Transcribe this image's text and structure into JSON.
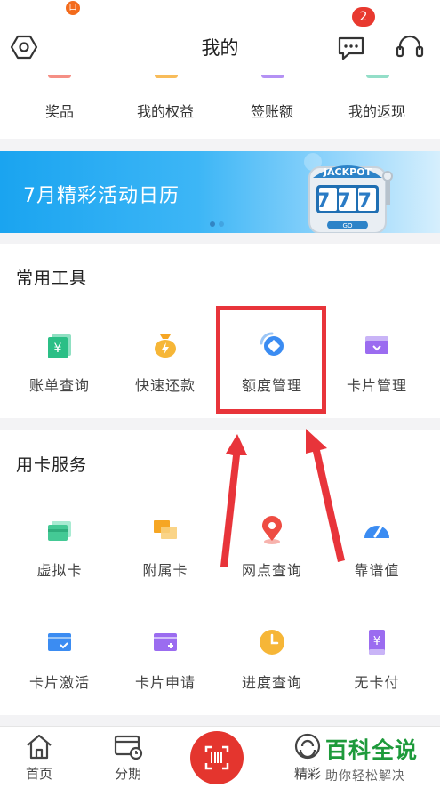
{
  "status": {
    "notif_glyph": "口"
  },
  "header": {
    "title": "我的",
    "message_badge": "2"
  },
  "quick_links": [
    "奖品",
    "我的权益",
    "签账额",
    "我的返现"
  ],
  "banner": {
    "text": "7月精彩活动日历",
    "jackpot_label": "JACKPOT",
    "jackpot_digits": "777",
    "jackpot_button": "GO"
  },
  "tools": {
    "title": "常用工具",
    "items": [
      "账单查询",
      "快速还款",
      "额度管理",
      "卡片管理"
    ],
    "highlighted": "额度管理"
  },
  "card_services": {
    "title": "用卡服务",
    "row1": [
      "虚拟卡",
      "附属卡",
      "网点查询",
      "靠谱值"
    ],
    "row2": [
      "卡片激活",
      "卡片申请",
      "进度查询",
      "无卡付"
    ]
  },
  "tabbar": {
    "tabs": [
      "首页",
      "分期",
      "精彩"
    ]
  },
  "watermark": {
    "main": "百科全说",
    "sub": "助你轻松解决"
  },
  "colors": {
    "accent_red": "#e8343a",
    "green": "#2bbf86",
    "orange": "#f6a623",
    "blue": "#3b8cf2",
    "purple": "#9b6cf0",
    "watermark": "#1e9a3b"
  }
}
